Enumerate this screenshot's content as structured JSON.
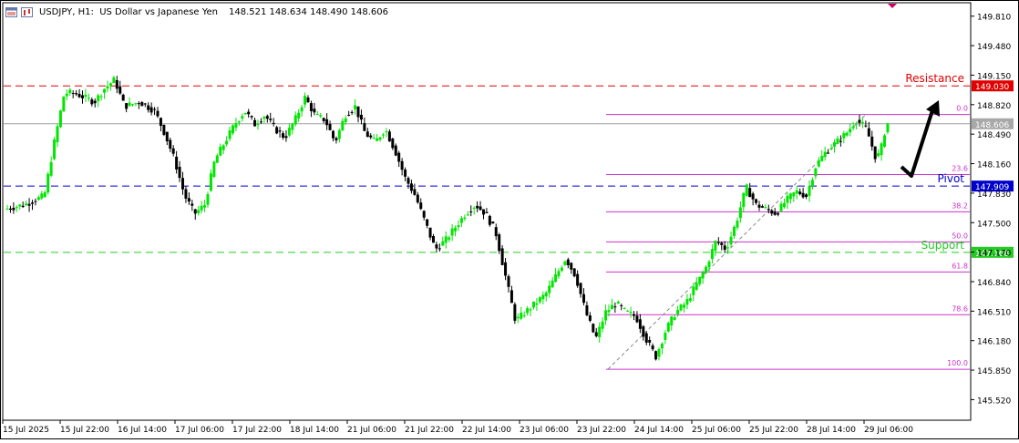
{
  "header": {
    "symbol_text": "USDJPY, H1:  US Dollar vs Japanese Yen",
    "ohlc_text": "148.521 148.634 148.490 148.606"
  },
  "colors": {
    "bull": "#00e600",
    "bear": "#000000",
    "resistance": "#e00000",
    "pivot": "#0000cc",
    "support": "#22cc22",
    "fib": "#cc33cc",
    "price_line": "#a0a0a0"
  },
  "chart_data": {
    "type": "candlestick",
    "title": "USDJPY, H1:  US Dollar vs Japanese Yen",
    "ylim": [
      145.3,
      149.95
    ],
    "y_ticks": [
      "149.810",
      "149.480",
      "149.150",
      "148.820",
      "148.490",
      "148.160",
      "147.830",
      "147.500",
      "147.170",
      "146.840",
      "146.510",
      "146.180",
      "145.850",
      "145.520"
    ],
    "x_ticks": [
      "15 Jul 2025",
      "15 Jul 22:00",
      "16 Jul 14:00",
      "17 Jul 06:00",
      "17 Jul 22:00",
      "18 Jul 14:00",
      "21 Jul 06:00",
      "21 Jul 22:00",
      "22 Jul 14:00",
      "23 Jul 06:00",
      "23 Jul 22:00",
      "24 Jul 14:00",
      "25 Jul 06:00",
      "25 Jul 22:00",
      "28 Jul 14:00",
      "29 Jul 06:00"
    ],
    "current_price": {
      "value": 148.606,
      "label": "148.606"
    },
    "levels": [
      {
        "name": "Resistance",
        "value": 149.03,
        "label": "149.030",
        "color_key": "resistance"
      },
      {
        "name": "Pivot",
        "value": 147.909,
        "label": "147.909",
        "color_key": "pivot"
      },
      {
        "name": "Support",
        "value": 147.168,
        "label": "147.168",
        "color_key": "support"
      }
    ],
    "fibonacci": {
      "low": 145.86,
      "high": 148.71,
      "levels": [
        {
          "ratio": 0.0,
          "label": "0.0"
        },
        {
          "ratio": 0.236,
          "label": "23.6"
        },
        {
          "ratio": 0.382,
          "label": "38.2"
        },
        {
          "ratio": 0.5,
          "label": "50.0"
        },
        {
          "ratio": 0.618,
          "label": "61.8"
        },
        {
          "ratio": 0.786,
          "label": "78.6"
        },
        {
          "ratio": 1.0,
          "label": "100.0"
        }
      ]
    },
    "price_path": [
      [
        0,
        147.65
      ],
      [
        4,
        147.7
      ],
      [
        8,
        147.8
      ],
      [
        10,
        148.4
      ],
      [
        12,
        148.95
      ],
      [
        14,
        148.95
      ],
      [
        18,
        148.85
      ],
      [
        20,
        149.0
      ],
      [
        22,
        149.1
      ],
      [
        24,
        148.8
      ],
      [
        27,
        148.85
      ],
      [
        30,
        148.75
      ],
      [
        32,
        148.5
      ],
      [
        34,
        148.2
      ],
      [
        36,
        147.8
      ],
      [
        38,
        147.6
      ],
      [
        40,
        147.7
      ],
      [
        42,
        148.2
      ],
      [
        44,
        148.4
      ],
      [
        46,
        148.6
      ],
      [
        48,
        148.75
      ],
      [
        50,
        148.6
      ],
      [
        52,
        148.7
      ],
      [
        54,
        148.55
      ],
      [
        56,
        148.45
      ],
      [
        58,
        148.65
      ],
      [
        60,
        148.9
      ],
      [
        62,
        148.7
      ],
      [
        64,
        148.65
      ],
      [
        66,
        148.4
      ],
      [
        68,
        148.7
      ],
      [
        70,
        148.8
      ],
      [
        72,
        148.5
      ],
      [
        74,
        148.4
      ],
      [
        76,
        148.55
      ],
      [
        78,
        148.3
      ],
      [
        80,
        148.0
      ],
      [
        82,
        147.8
      ],
      [
        84,
        147.5
      ],
      [
        86,
        147.2
      ],
      [
        88,
        147.3
      ],
      [
        90,
        147.45
      ],
      [
        92,
        147.6
      ],
      [
        94,
        147.7
      ],
      [
        96,
        147.6
      ],
      [
        98,
        147.4
      ],
      [
        100,
        146.9
      ],
      [
        102,
        146.4
      ],
      [
        104,
        146.5
      ],
      [
        106,
        146.6
      ],
      [
        108,
        146.7
      ],
      [
        110,
        146.9
      ],
      [
        112,
        147.1
      ],
      [
        114,
        146.9
      ],
      [
        116,
        146.5
      ],
      [
        118,
        146.2
      ],
      [
        120,
        146.5
      ],
      [
        122,
        146.6
      ],
      [
        124,
        146.5
      ],
      [
        126,
        146.45
      ],
      [
        128,
        146.2
      ],
      [
        130,
        146.0
      ],
      [
        132,
        146.3
      ],
      [
        134,
        146.5
      ],
      [
        136,
        146.6
      ],
      [
        138,
        146.8
      ],
      [
        140,
        147.0
      ],
      [
        142,
        147.3
      ],
      [
        144,
        147.2
      ],
      [
        146,
        147.5
      ],
      [
        148,
        147.9
      ],
      [
        150,
        147.7
      ],
      [
        152,
        147.65
      ],
      [
        154,
        147.6
      ],
      [
        156,
        147.75
      ],
      [
        158,
        147.85
      ],
      [
        160,
        147.8
      ],
      [
        162,
        148.15
      ],
      [
        164,
        148.3
      ],
      [
        166,
        148.4
      ],
      [
        168,
        148.5
      ],
      [
        170,
        148.65
      ],
      [
        172,
        148.55
      ],
      [
        174,
        148.2
      ],
      [
        175,
        148.35
      ],
      [
        176,
        148.61
      ]
    ]
  },
  "annotations": {
    "resistance_label": "Resistance",
    "pivot_label": "Pivot",
    "support_label": "Support"
  }
}
